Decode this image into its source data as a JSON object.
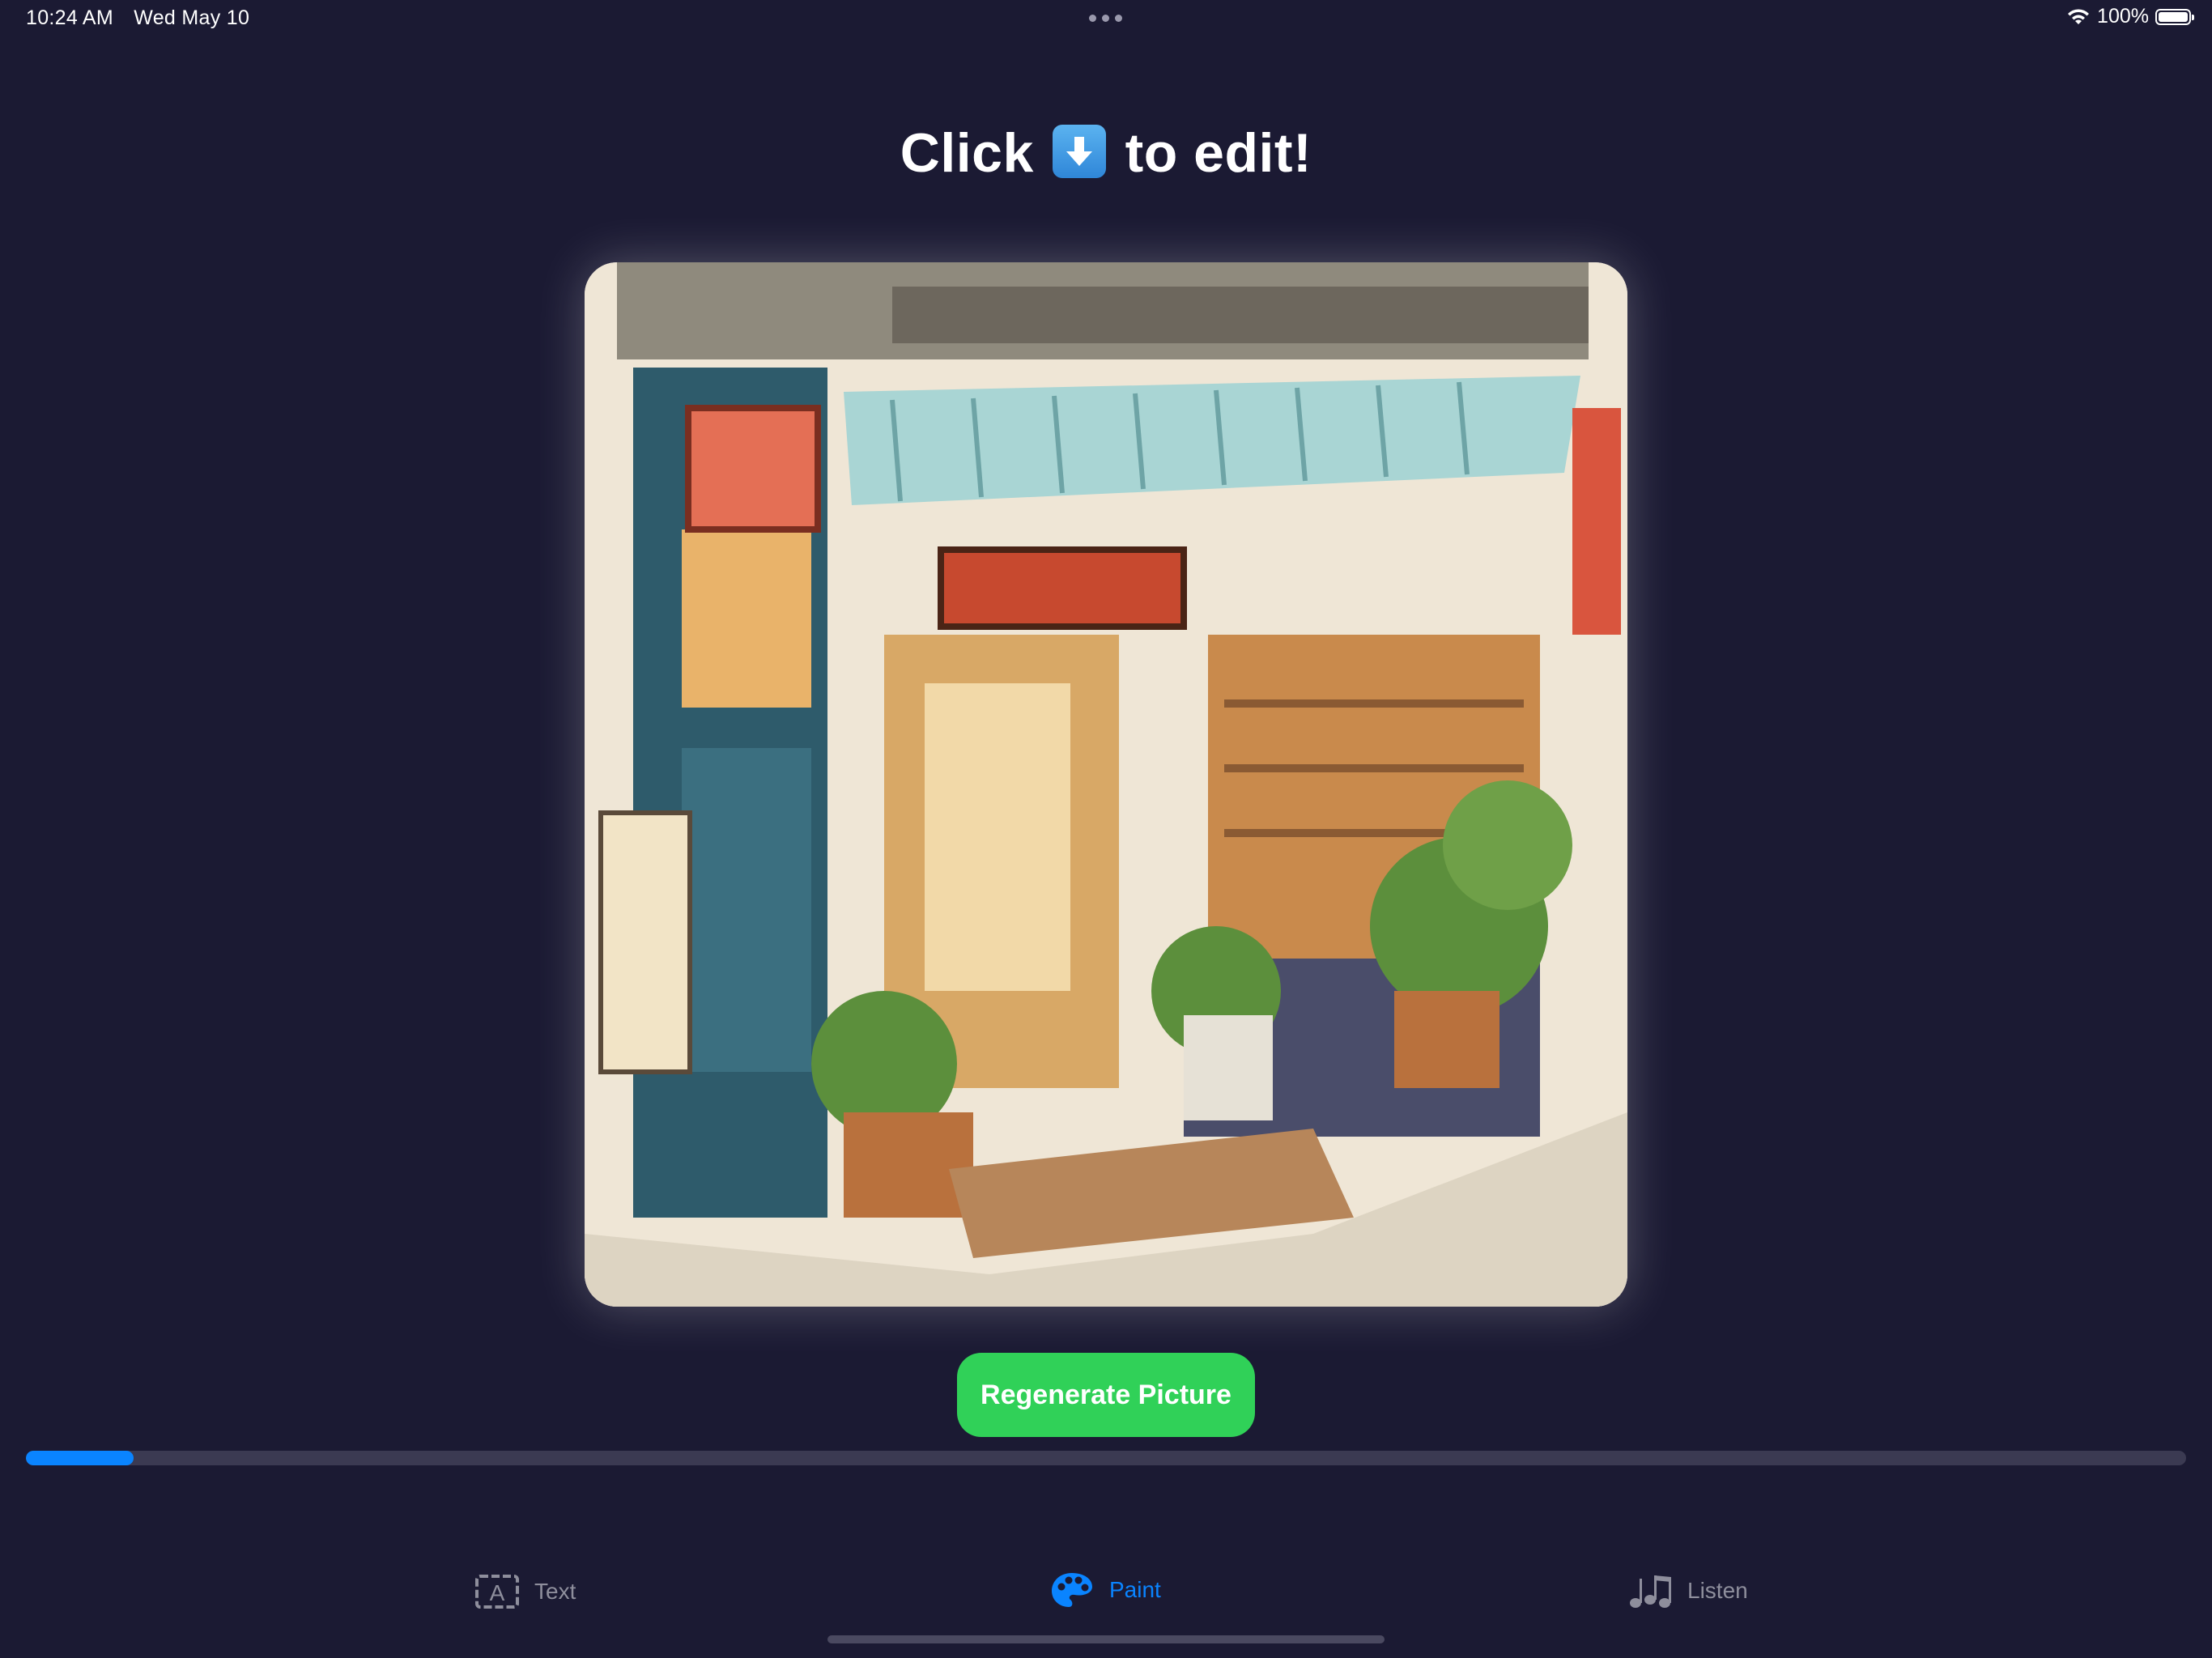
{
  "status": {
    "time": "10:24 AM",
    "date": "Wed May 10",
    "battery": "100%"
  },
  "header": {
    "title_before": "Click",
    "title_after": "to edit!",
    "emoji": "down-arrow-icon"
  },
  "picture": {
    "description_icon": "shop-illustration"
  },
  "actions": {
    "regenerate_label": "Regenerate Picture"
  },
  "progress": {
    "value": 0.05
  },
  "tabs": [
    {
      "label": "Text",
      "icon": "text-box-icon",
      "active": false
    },
    {
      "label": "Paint",
      "icon": "palette-icon",
      "active": true
    },
    {
      "label": "Listen",
      "icon": "music-notes-icon",
      "active": false
    }
  ],
  "colors": {
    "background": "#1b1a33",
    "accent": "#0a84ff",
    "button": "#30d158"
  }
}
